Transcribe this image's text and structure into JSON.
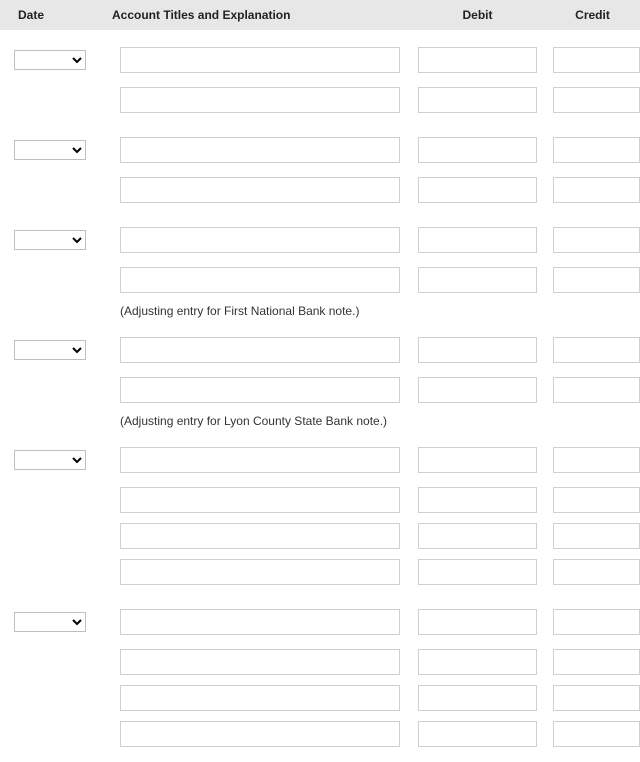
{
  "header": {
    "date": "Date",
    "account": "Account Titles and Explanation",
    "debit": "Debit",
    "credit": "Credit"
  },
  "explanations": {
    "first_national": "(Adjusting entry for First National Bank note.)",
    "lyon_county": "(Adjusting entry for Lyon County State Bank note.)"
  },
  "groups": [
    {
      "show_date": true,
      "lines": 2,
      "explain_after": null
    },
    {
      "show_date": true,
      "lines": 2,
      "explain_after": null
    },
    {
      "show_date": true,
      "lines": 2,
      "explain_after": "first_national"
    },
    {
      "show_date": true,
      "lines": 2,
      "explain_after": "lyon_county"
    },
    {
      "show_date": true,
      "lines": 4,
      "explain_after": null
    },
    {
      "show_date": true,
      "lines": 4,
      "explain_after": null
    }
  ],
  "values": {
    "dates": [
      "",
      "",
      "",
      "",
      "",
      ""
    ],
    "accounts": [
      [
        "",
        ""
      ],
      [
        "",
        ""
      ],
      [
        "",
        ""
      ],
      [
        "",
        ""
      ],
      [
        "",
        "",
        "",
        ""
      ],
      [
        "",
        "",
        "",
        ""
      ]
    ],
    "debits": [
      [
        "",
        ""
      ],
      [
        "",
        ""
      ],
      [
        "",
        ""
      ],
      [
        "",
        ""
      ],
      [
        "",
        "",
        "",
        ""
      ],
      [
        "",
        "",
        "",
        ""
      ]
    ],
    "credits": [
      [
        "",
        ""
      ],
      [
        "",
        ""
      ],
      [
        "",
        ""
      ],
      [
        "",
        ""
      ],
      [
        "",
        "",
        "",
        ""
      ],
      [
        "",
        "",
        "",
        ""
      ]
    ]
  }
}
